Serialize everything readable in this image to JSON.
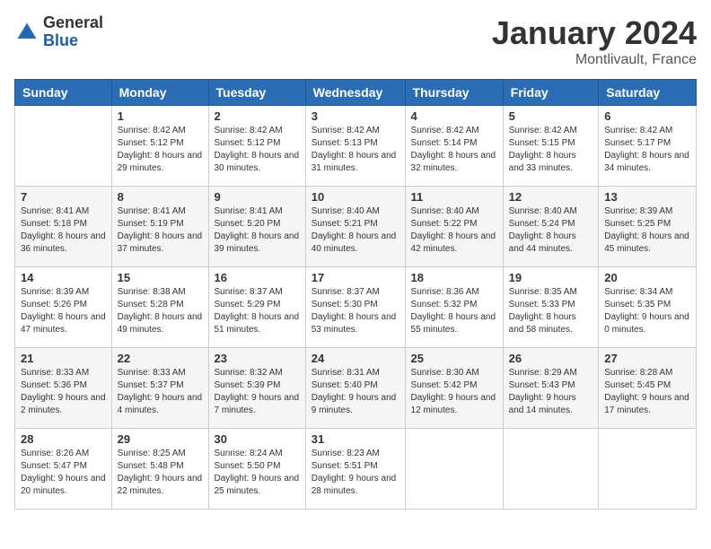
{
  "header": {
    "logo_general": "General",
    "logo_blue": "Blue",
    "month_year": "January 2024",
    "location": "Montlivault, France"
  },
  "days_of_week": [
    "Sunday",
    "Monday",
    "Tuesday",
    "Wednesday",
    "Thursday",
    "Friday",
    "Saturday"
  ],
  "weeks": [
    [
      {
        "day": "",
        "sunrise": "",
        "sunset": "",
        "daylight": ""
      },
      {
        "day": "1",
        "sunrise": "Sunrise: 8:42 AM",
        "sunset": "Sunset: 5:12 PM",
        "daylight": "Daylight: 8 hours and 29 minutes."
      },
      {
        "day": "2",
        "sunrise": "Sunrise: 8:42 AM",
        "sunset": "Sunset: 5:12 PM",
        "daylight": "Daylight: 8 hours and 30 minutes."
      },
      {
        "day": "3",
        "sunrise": "Sunrise: 8:42 AM",
        "sunset": "Sunset: 5:13 PM",
        "daylight": "Daylight: 8 hours and 31 minutes."
      },
      {
        "day": "4",
        "sunrise": "Sunrise: 8:42 AM",
        "sunset": "Sunset: 5:14 PM",
        "daylight": "Daylight: 8 hours and 32 minutes."
      },
      {
        "day": "5",
        "sunrise": "Sunrise: 8:42 AM",
        "sunset": "Sunset: 5:15 PM",
        "daylight": "Daylight: 8 hours and 33 minutes."
      },
      {
        "day": "6",
        "sunrise": "Sunrise: 8:42 AM",
        "sunset": "Sunset: 5:17 PM",
        "daylight": "Daylight: 8 hours and 34 minutes."
      }
    ],
    [
      {
        "day": "7",
        "sunrise": "Sunrise: 8:41 AM",
        "sunset": "Sunset: 5:18 PM",
        "daylight": "Daylight: 8 hours and 36 minutes."
      },
      {
        "day": "8",
        "sunrise": "Sunrise: 8:41 AM",
        "sunset": "Sunset: 5:19 PM",
        "daylight": "Daylight: 8 hours and 37 minutes."
      },
      {
        "day": "9",
        "sunrise": "Sunrise: 8:41 AM",
        "sunset": "Sunset: 5:20 PM",
        "daylight": "Daylight: 8 hours and 39 minutes."
      },
      {
        "day": "10",
        "sunrise": "Sunrise: 8:40 AM",
        "sunset": "Sunset: 5:21 PM",
        "daylight": "Daylight: 8 hours and 40 minutes."
      },
      {
        "day": "11",
        "sunrise": "Sunrise: 8:40 AM",
        "sunset": "Sunset: 5:22 PM",
        "daylight": "Daylight: 8 hours and 42 minutes."
      },
      {
        "day": "12",
        "sunrise": "Sunrise: 8:40 AM",
        "sunset": "Sunset: 5:24 PM",
        "daylight": "Daylight: 8 hours and 44 minutes."
      },
      {
        "day": "13",
        "sunrise": "Sunrise: 8:39 AM",
        "sunset": "Sunset: 5:25 PM",
        "daylight": "Daylight: 8 hours and 45 minutes."
      }
    ],
    [
      {
        "day": "14",
        "sunrise": "Sunrise: 8:39 AM",
        "sunset": "Sunset: 5:26 PM",
        "daylight": "Daylight: 8 hours and 47 minutes."
      },
      {
        "day": "15",
        "sunrise": "Sunrise: 8:38 AM",
        "sunset": "Sunset: 5:28 PM",
        "daylight": "Daylight: 8 hours and 49 minutes."
      },
      {
        "day": "16",
        "sunrise": "Sunrise: 8:37 AM",
        "sunset": "Sunset: 5:29 PM",
        "daylight": "Daylight: 8 hours and 51 minutes."
      },
      {
        "day": "17",
        "sunrise": "Sunrise: 8:37 AM",
        "sunset": "Sunset: 5:30 PM",
        "daylight": "Daylight: 8 hours and 53 minutes."
      },
      {
        "day": "18",
        "sunrise": "Sunrise: 8:36 AM",
        "sunset": "Sunset: 5:32 PM",
        "daylight": "Daylight: 8 hours and 55 minutes."
      },
      {
        "day": "19",
        "sunrise": "Sunrise: 8:35 AM",
        "sunset": "Sunset: 5:33 PM",
        "daylight": "Daylight: 8 hours and 58 minutes."
      },
      {
        "day": "20",
        "sunrise": "Sunrise: 8:34 AM",
        "sunset": "Sunset: 5:35 PM",
        "daylight": "Daylight: 9 hours and 0 minutes."
      }
    ],
    [
      {
        "day": "21",
        "sunrise": "Sunrise: 8:33 AM",
        "sunset": "Sunset: 5:36 PM",
        "daylight": "Daylight: 9 hours and 2 minutes."
      },
      {
        "day": "22",
        "sunrise": "Sunrise: 8:33 AM",
        "sunset": "Sunset: 5:37 PM",
        "daylight": "Daylight: 9 hours and 4 minutes."
      },
      {
        "day": "23",
        "sunrise": "Sunrise: 8:32 AM",
        "sunset": "Sunset: 5:39 PM",
        "daylight": "Daylight: 9 hours and 7 minutes."
      },
      {
        "day": "24",
        "sunrise": "Sunrise: 8:31 AM",
        "sunset": "Sunset: 5:40 PM",
        "daylight": "Daylight: 9 hours and 9 minutes."
      },
      {
        "day": "25",
        "sunrise": "Sunrise: 8:30 AM",
        "sunset": "Sunset: 5:42 PM",
        "daylight": "Daylight: 9 hours and 12 minutes."
      },
      {
        "day": "26",
        "sunrise": "Sunrise: 8:29 AM",
        "sunset": "Sunset: 5:43 PM",
        "daylight": "Daylight: 9 hours and 14 minutes."
      },
      {
        "day": "27",
        "sunrise": "Sunrise: 8:28 AM",
        "sunset": "Sunset: 5:45 PM",
        "daylight": "Daylight: 9 hours and 17 minutes."
      }
    ],
    [
      {
        "day": "28",
        "sunrise": "Sunrise: 8:26 AM",
        "sunset": "Sunset: 5:47 PM",
        "daylight": "Daylight: 9 hours and 20 minutes."
      },
      {
        "day": "29",
        "sunrise": "Sunrise: 8:25 AM",
        "sunset": "Sunset: 5:48 PM",
        "daylight": "Daylight: 9 hours and 22 minutes."
      },
      {
        "day": "30",
        "sunrise": "Sunrise: 8:24 AM",
        "sunset": "Sunset: 5:50 PM",
        "daylight": "Daylight: 9 hours and 25 minutes."
      },
      {
        "day": "31",
        "sunrise": "Sunrise: 8:23 AM",
        "sunset": "Sunset: 5:51 PM",
        "daylight": "Daylight: 9 hours and 28 minutes."
      },
      {
        "day": "",
        "sunrise": "",
        "sunset": "",
        "daylight": ""
      },
      {
        "day": "",
        "sunrise": "",
        "sunset": "",
        "daylight": ""
      },
      {
        "day": "",
        "sunrise": "",
        "sunset": "",
        "daylight": ""
      }
    ]
  ]
}
